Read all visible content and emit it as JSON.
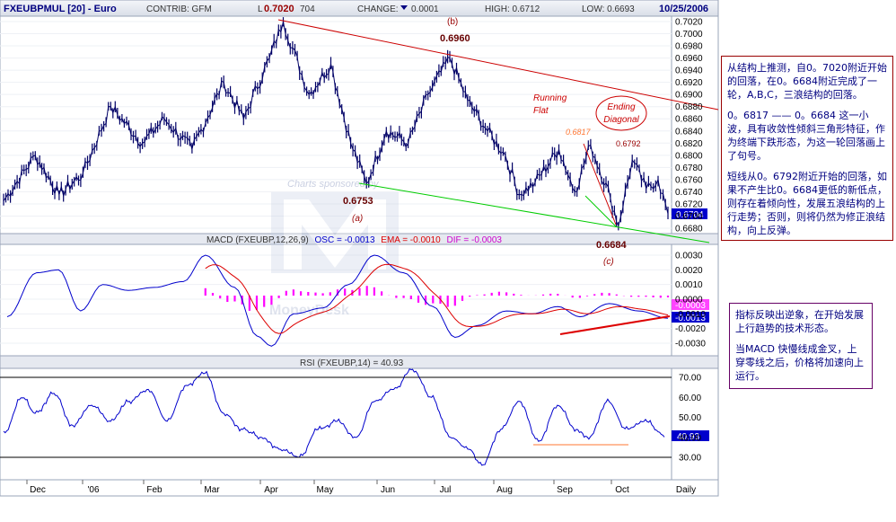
{
  "header": {
    "symbol": "FXEUBPMUL [20] - Euro",
    "contrib": "CONTRIB: GFM",
    "last_prefix": "L",
    "last": "0.7020",
    "last_extra": "704",
    "change": "CHANGE:",
    "change_val": "0.0001",
    "high": "HIGH: 0.6712",
    "low": "LOW: 0.6693",
    "date": "10/25/2006"
  },
  "watermark": "Charts sponsored by",
  "watermark_brand": "MoneyDesk",
  "price_panel": {
    "y_ticks": [
      "0.7020",
      "0.7000",
      "0.6980",
      "0.6960",
      "0.6940",
      "0.6920",
      "0.6900",
      "0.6880",
      "0.6860",
      "0.6840",
      "0.6820",
      "0.6800",
      "0.6780",
      "0.6760",
      "0.6740",
      "0.6720",
      "0.6700",
      "0.6680"
    ],
    "last_badge": "0.6704",
    "annotations": {
      "b_label": "(b)",
      "b_val": "0.6960",
      "a_label": "(a)",
      "a_val": "0.6753",
      "c_label": "(c)",
      "c_val": "0.6684",
      "running_flat": "Running Flat",
      "ending_diag": "Ending Diagonal",
      "v6817": "0.6817",
      "v6792": "0.6792"
    }
  },
  "macd_panel": {
    "title_name": "MACD (FXEUBP,12,26,9)",
    "osc": "OSC = -0.0013",
    "ema": "EMA = -0.0010",
    "dif": "DIF = -0.0003",
    "y_ticks": [
      "0.0030",
      "0.0020",
      "0.0010",
      "0.0000",
      "-0.0010",
      "-0.0020",
      "-0.0030"
    ],
    "badge_pink": "-0.0003",
    "badge_blue": "-0.0013"
  },
  "rsi_panel": {
    "title": "RSI (FXEUBP,14) = 40.93",
    "y_ticks": [
      "70.00",
      "60.00",
      "50.00",
      "40.00",
      "30.00"
    ],
    "badge": "40.93"
  },
  "x_axis": {
    "labels": [
      "Dec",
      "'06",
      "Feb",
      "Mar",
      "Apr",
      "May",
      "Jun",
      "Jul",
      "Aug",
      "Sep",
      "Oct",
      "Daily"
    ]
  },
  "notes": {
    "n1_p1": "从结构上推测，自0。7020附近开始的回落，在0。6684附近完成了一轮，A,B,C，三浪结构的回落。",
    "n1_p2": "0。6817 —— 0。6684 这一小波，具有收敛性倾斜三角形特征，作为终端下跌形态，为这一轮回落画上了句号。",
    "n1_p3": "短线从0。6792附近开始的回落，如果不产生比0。6684更低的新低点，则存在着倾向性，发展五浪结构的上行走势；否则，则将仍然为修正浪结构，向上反弹。",
    "n2_p1": "指标反映出逆象，在开始发展上行趋势的技术形态。",
    "n2_p2": "当MACD 快慢线成金叉，上穿零线之后，价格将加速向上运行。"
  },
  "colors": {
    "price": "#000066",
    "macd_line": "#0000cc",
    "signal_line": "#dd0000",
    "histogram": "#ff00ff",
    "rsi": "#0000cc",
    "upper_trend": "#cc0000",
    "lower_trend": "#00cc00",
    "annotation": "#cc0000"
  },
  "chart_data": {
    "type": "line",
    "title": "FXEUBPMUL [20] - Euro",
    "xlabel": "",
    "ylabel": "",
    "x_range": [
      "Nov 2005",
      "Oct 2006"
    ],
    "ylim": [
      0.667,
      0.703
    ],
    "price_pivots": [
      [
        "2005-11-24",
        0.6725
      ],
      [
        "2005-12-10",
        0.68
      ],
      [
        "2005-12-22",
        0.6735
      ],
      [
        "2006-01-03",
        0.677
      ],
      [
        "2006-01-17",
        0.688
      ],
      [
        "2006-02-02",
        0.682
      ],
      [
        "2006-02-13",
        0.686
      ],
      [
        "2006-02-27",
        0.681
      ],
      [
        "2006-03-15",
        0.692
      ],
      [
        "2006-03-25",
        0.686
      ],
      [
        "2006-04-07",
        0.696
      ],
      [
        "2006-04-14",
        0.702
      ],
      [
        "2006-04-27",
        0.69
      ],
      [
        "2006-05-08",
        0.695
      ],
      [
        "2006-05-18",
        0.682
      ],
      [
        "2006-05-26",
        0.6753
      ],
      [
        "2006-06-05",
        0.684
      ],
      [
        "2006-06-16",
        0.682
      ],
      [
        "2006-06-26",
        0.69
      ],
      [
        "2006-07-07",
        0.696
      ],
      [
        "2006-07-16",
        0.689
      ],
      [
        "2006-07-26",
        0.684
      ],
      [
        "2006-08-04",
        0.68
      ],
      [
        "2006-08-11",
        0.6735
      ],
      [
        "2006-08-19",
        0.6755
      ],
      [
        "2006-08-31",
        0.681
      ],
      [
        "2006-09-08",
        0.674
      ],
      [
        "2006-09-16",
        0.6817
      ],
      [
        "2006-09-26",
        0.673
      ],
      [
        "2006-09-30",
        0.6684
      ],
      [
        "2006-10-07",
        0.6792
      ],
      [
        "2006-10-14",
        0.6745
      ],
      [
        "2006-10-20",
        0.676
      ],
      [
        "2006-10-25",
        0.6704
      ]
    ],
    "price_labels": [
      {
        "label": "(b)",
        "value": 0.696
      },
      {
        "label": "(a)",
        "value": 0.6753
      },
      {
        "label": "(c)",
        "value": 0.6684
      },
      {
        "label": "Running Flat"
      },
      {
        "label": "Ending Diagonal"
      },
      {
        "label": "0.6817",
        "value": 0.6817
      },
      {
        "label": "0.6792",
        "value": 0.6792
      }
    ],
    "macd": {
      "ylim": [
        -0.0035,
        0.0035
      ],
      "osc": -0.0013,
      "ema": -0.001,
      "dif": -0.0003,
      "macd_pivots": [
        [
          0,
          -0.0012
        ],
        [
          8,
          0.0018
        ],
        [
          14,
          0.002
        ],
        [
          20,
          -0.0008
        ],
        [
          26,
          0.001
        ],
        [
          33,
          0.0006
        ],
        [
          40,
          0.0008
        ],
        [
          48,
          0.0012
        ],
        [
          54,
          0.003
        ],
        [
          62,
          0.0008
        ],
        [
          68,
          -0.0025
        ],
        [
          72,
          -0.0032
        ],
        [
          78,
          -0.001
        ],
        [
          86,
          -0.0006
        ],
        [
          93,
          0.001
        ],
        [
          100,
          0.003
        ],
        [
          108,
          0.0018
        ],
        [
          116,
          -0.0005
        ],
        [
          122,
          -0.0026
        ],
        [
          128,
          -0.0018
        ],
        [
          136,
          -0.0008
        ],
        [
          143,
          -0.001
        ],
        [
          150,
          -0.0005
        ],
        [
          156,
          -0.0012
        ],
        [
          164,
          -0.0003
        ],
        [
          172,
          -0.0008
        ],
        [
          180,
          -0.0013
        ]
      ]
    },
    "rsi": {
      "ylim": [
        20,
        75
      ],
      "last": 40.93,
      "levels": [
        70,
        30
      ],
      "rsi_pivots": [
        [
          0,
          42
        ],
        [
          6,
          60
        ],
        [
          10,
          52
        ],
        [
          16,
          62
        ],
        [
          22,
          46
        ],
        [
          28,
          56
        ],
        [
          34,
          48
        ],
        [
          40,
          58
        ],
        [
          46,
          64
        ],
        [
          52,
          48
        ],
        [
          58,
          66
        ],
        [
          64,
          72
        ],
        [
          70,
          52
        ],
        [
          76,
          44
        ],
        [
          82,
          40
        ],
        [
          88,
          34
        ],
        [
          94,
          30
        ],
        [
          100,
          44
        ],
        [
          106,
          48
        ],
        [
          112,
          40
        ],
        [
          118,
          58
        ],
        [
          124,
          64
        ],
        [
          130,
          74
        ],
        [
          136,
          60
        ],
        [
          142,
          40
        ],
        [
          148,
          34
        ],
        [
          152,
          26
        ],
        [
          158,
          44
        ],
        [
          164,
          58
        ],
        [
          170,
          38
        ],
        [
          176,
          56
        ],
        [
          182,
          44
        ],
        [
          186,
          40
        ],
        [
          192,
          58
        ],
        [
          198,
          44
        ],
        [
          204,
          48
        ],
        [
          210,
          41
        ]
      ]
    }
  }
}
